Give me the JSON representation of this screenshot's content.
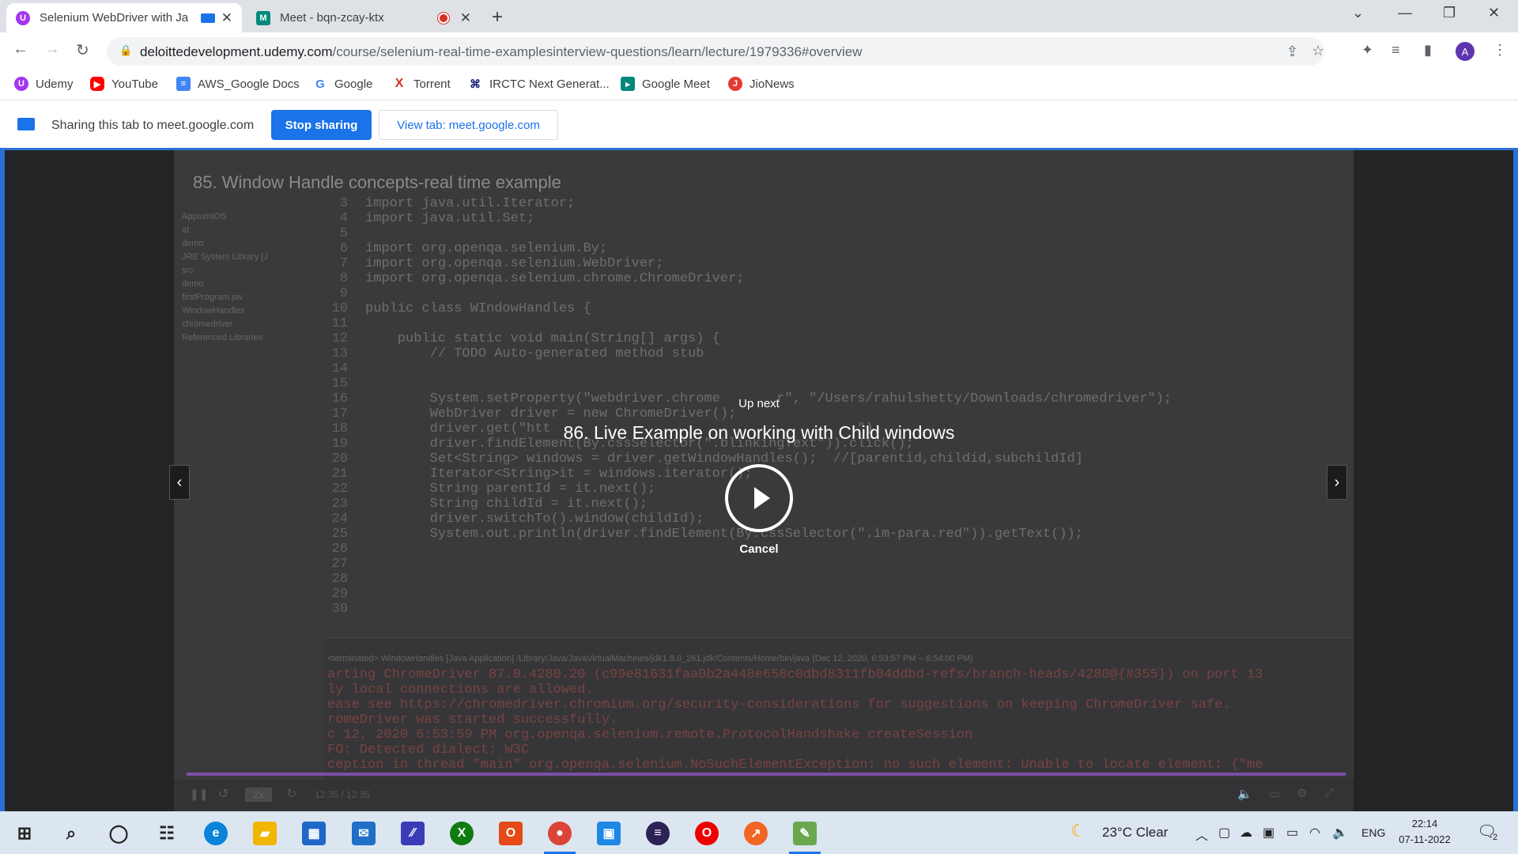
{
  "browser": {
    "tabs": [
      {
        "title": "Selenium WebDriver with Ja",
        "active": true
      },
      {
        "title": "Meet - bqn-zcay-ktx",
        "active": false
      }
    ],
    "address": {
      "domain": "deloittedevelopment.udemy.com",
      "path": "/course/selenium-real-time-examplesinterview-questions/learn/lecture/1979336#overview"
    },
    "profile_initial": "A",
    "bookmarks": [
      {
        "label": "Udemy",
        "icon": "udemy-icon",
        "color": "#a435f0"
      },
      {
        "label": "YouTube",
        "icon": "youtube-icon",
        "color": "#ff0000"
      },
      {
        "label": "AWS_Google Docs",
        "icon": "docs-icon",
        "color": "#4285f4"
      },
      {
        "label": "Google",
        "icon": "google-icon",
        "color": "#4285f4"
      },
      {
        "label": "Torrent",
        "icon": "torrent-icon",
        "color": "#d93025"
      },
      {
        "label": "IRCTC Next Generat...",
        "icon": "irctc-icon",
        "color": "#1a237e"
      },
      {
        "label": "Google Meet",
        "icon": "meet-icon",
        "color": "#00897b"
      },
      {
        "label": "JioNews",
        "icon": "jionews-icon",
        "color": "#e53935"
      }
    ]
  },
  "share_bar": {
    "text": "Sharing this tab to meet.google.com",
    "stop_label": "Stop sharing",
    "view_label": "View tab: meet.google.com"
  },
  "player": {
    "lecture_title": "85. Window Handle concepts-real time example",
    "up_next_label": "Up next",
    "next_title": "86. Live Example on working with Child windows",
    "cancel_label": "Cancel",
    "speed": "2x",
    "time": "12:35 / 12:35",
    "tree": [
      "AppiumIOS",
      "at",
      "demo",
      "JRE System Library [J",
      "src",
      "demo",
      "firstProgram.jav",
      "WindowHandles",
      "chromedriver",
      "Referenced Libraries"
    ],
    "line_numbers": [
      "3",
      "4",
      "5",
      "6",
      "7",
      "8",
      "9",
      "10",
      "11",
      "12",
      "13",
      "14",
      "15",
      "16",
      "17",
      "18",
      "19",
      "20",
      "21",
      "22",
      "23",
      "24",
      "25",
      "26",
      "27",
      "28",
      "29",
      "30"
    ],
    "code_lines": [
      "import java.util.Iterator;",
      "import java.util.Set;",
      "",
      "import org.openqa.selenium.By;",
      "import org.openqa.selenium.WebDriver;",
      "import org.openqa.selenium.chrome.ChromeDriver;",
      "",
      "public class WIndowHandles {",
      "",
      "    public static void main(String[] args) {",
      "        // TODO Auto-generated method stub",
      "",
      "",
      "        System.setProperty(\"webdriver.chrome       r\", \"/Users/rahulshetty/Downloads/chromedriver\");",
      "        WebDriver driver = new ChromeDriver();",
      "        driver.get(\"htt                                      \");",
      "        driver.findElement(By.cssSelector(\".blinkingText\")).click();",
      "        Set<String> windows = driver.getWindowHandles();  //[parentid,childid,subchildId]",
      "        Iterator<String>it = windows.iterator();",
      "        String parentId = it.next();",
      "        String childId = it.next();",
      "        driver.switchTo().window(childId);",
      "        System.out.println(driver.findElement(By.cssSelector(\".im-para.red\")).getText());",
      "",
      "",
      "",
      "",
      ""
    ],
    "console_meta": "<terminated> WindowHandles [Java Application] /Library/Java/JavaVirtualMachines/jdk1.8.0_261.jdk/Contents/Home/bin/java (Dec 12, 2020, 6:53:57 PM – 6:54:00 PM)",
    "console_lines": [
      "arting ChromeDriver 87.0.4280.20 (c99e81631faa0b2a448e658c0dbd8311fb04ddbd-refs/branch-heads/4280@{#355}) on port 13",
      "ly local connections are allowed.",
      "ease see https://chromedriver.chromium.org/security-considerations for suggestions on keeping ChromeDriver safe.",
      "romeDriver was started successfully.",
      "c 12, 2020 6:53:59 PM org.openqa.selenium.remote.ProtocolHandshake createSession",
      "FO: Detected dialect: W3C",
      "ception in thread \"main\" org.openqa.selenium.NoSuchElementException: no such element: Unable to locate element: {\"me"
    ],
    "progress": 1.0
  },
  "taskbar": {
    "weather": "23°C  Clear",
    "language": "ENG",
    "time": "22:14",
    "date": "07-11-2022",
    "notification_count": "2"
  }
}
